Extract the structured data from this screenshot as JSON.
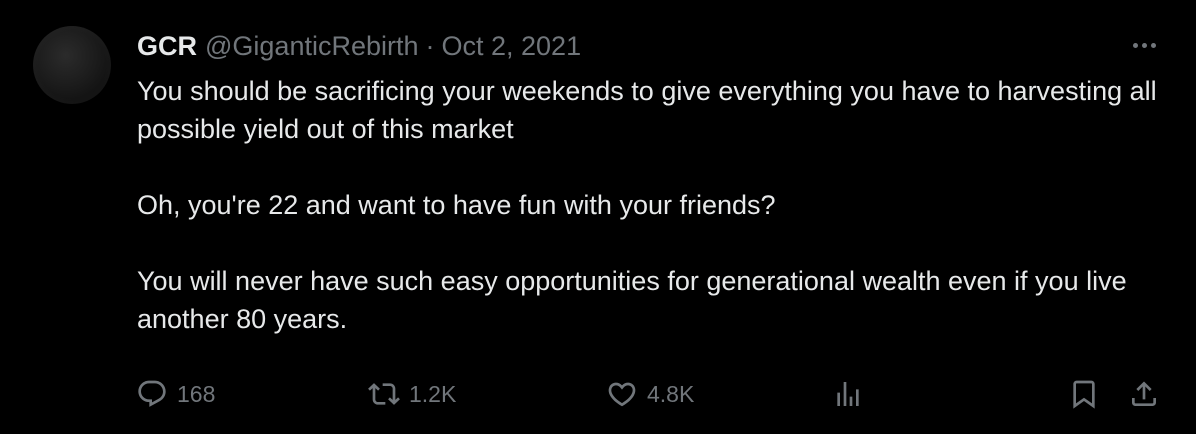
{
  "tweet": {
    "display_name": "GCR",
    "handle": "@GiganticRebirth",
    "separator": "·",
    "date": "Oct 2, 2021",
    "paragraphs": [
      "You should be sacrificing your weekends to give everything you have to harvesting all possible yield out of this market",
      "Oh, you're 22 and want to have fun with your friends?",
      "You will never have such easy opportunities for generational wealth even if you live another 80 years."
    ]
  },
  "actions": {
    "replies": "168",
    "reposts": "1.2K",
    "likes": "4.8K"
  },
  "icons": {
    "more": "more-horizontal-icon",
    "reply": "reply-icon",
    "repost": "repost-icon",
    "like": "heart-icon",
    "views": "analytics-icon",
    "bookmark": "bookmark-icon",
    "share": "share-icon"
  },
  "colors": {
    "background": "#000000",
    "primary_text": "#e7e9ea",
    "secondary_text": "#71767b"
  }
}
